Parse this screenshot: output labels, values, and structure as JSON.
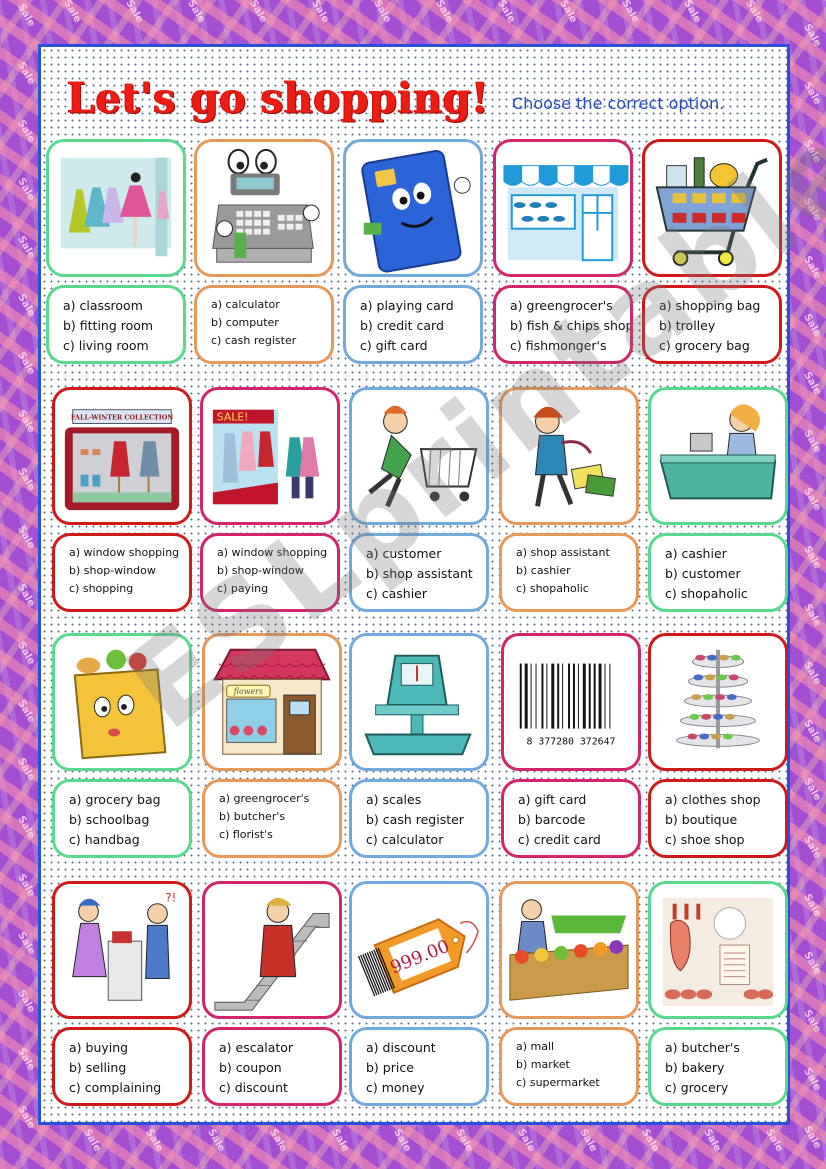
{
  "worksheet": {
    "title": "Let's go shopping!",
    "instructions": "Choose the correct option.",
    "background_tag_text": "Sale",
    "watermark": "ESLprintables.com",
    "colors": {
      "title": "#ee1c13",
      "instructions": "#2848c8",
      "panel_border": "#2950d8",
      "background": "#a24fd1",
      "green": "#58d98e",
      "orange": "#e6995a",
      "blue": "#72aadb",
      "pink": "#d1256c",
      "red": "#d01a1a"
    },
    "items": [
      {
        "image": "fitting-room-illustration",
        "color": "green",
        "options": [
          "a) classroom",
          "b) fitting room",
          "c) living room"
        ]
      },
      {
        "image": "cash-register-illustration",
        "color": "orange",
        "options": [
          "a) calculator",
          "b) computer",
          "c) cash register"
        ]
      },
      {
        "image": "credit-card-illustration",
        "color": "blue",
        "options": [
          "a) playing card",
          "b) credit card",
          "c) gift card"
        ]
      },
      {
        "image": "fishmonger-shop-illustration",
        "color": "pink",
        "options": [
          "a) greengrocer's",
          "b) fish & chips shop",
          "c) fishmonger's"
        ]
      },
      {
        "image": "shopping-trolley-illustration",
        "color": "red",
        "options": [
          "a) shopping bag",
          "b) trolley",
          "c) grocery bag"
        ]
      },
      {
        "image": "shop-window-illustration",
        "color": "red",
        "image_text": "FALL-WINTER COLLECTION",
        "options": [
          "a) window shopping",
          "b) shop-window",
          "c) shopping"
        ]
      },
      {
        "image": "window-shopping-illustration",
        "color": "pink",
        "image_text": "SALE!",
        "options": [
          "a) window shopping",
          "b) shop-window",
          "c) paying"
        ]
      },
      {
        "image": "customer-with-trolley-illustration",
        "color": "blue",
        "options": [
          "a) customer",
          "b) shop assistant",
          "c) cashier"
        ]
      },
      {
        "image": "shopaholic-illustration",
        "color": "orange",
        "options": [
          "a) shop assistant",
          "b) cashier",
          "c) shopaholic"
        ]
      },
      {
        "image": "cashier-illustration",
        "color": "green",
        "options": [
          "a) cashier",
          "b) customer",
          "c) shopaholic"
        ]
      },
      {
        "image": "grocery-bag-illustration",
        "color": "green",
        "options": [
          "a) grocery bag",
          "b) schoolbag",
          "c) handbag"
        ]
      },
      {
        "image": "florist-shop-illustration",
        "color": "orange",
        "image_text": "flowers",
        "options": [
          "a) greengrocer's",
          "b) butcher's",
          "c) florist's"
        ]
      },
      {
        "image": "scales-illustration",
        "color": "blue",
        "options": [
          "a) scales",
          "b) cash register",
          "c) calculator"
        ]
      },
      {
        "image": "barcode-illustration",
        "color": "pink",
        "image_text": "8 377280 372647",
        "options": [
          "a) gift card",
          "b) barcode",
          "c) credit card"
        ]
      },
      {
        "image": "shoe-display-illustration",
        "color": "red",
        "options": [
          "a) clothes shop",
          "b) boutique",
          "c) shoe shop"
        ]
      },
      {
        "image": "complaining-customer-illustration",
        "color": "red",
        "options": [
          "a) buying",
          "b) selling",
          "c) complaining"
        ]
      },
      {
        "image": "escalator-illustration",
        "color": "pink",
        "options": [
          "a) escalator",
          "b) coupon",
          "c) discount"
        ]
      },
      {
        "image": "price-tag-illustration",
        "color": "blue",
        "image_text": "999.00",
        "options": [
          "a) discount",
          "b) price",
          "c) money"
        ]
      },
      {
        "image": "market-stall-illustration",
        "color": "orange",
        "options": [
          "a) mall",
          "b) market",
          "c) supermarket"
        ]
      },
      {
        "image": "butcher-shop-illustration",
        "color": "green",
        "options": [
          "a) butcher's",
          "b) bakery",
          "c) grocery"
        ]
      }
    ]
  }
}
